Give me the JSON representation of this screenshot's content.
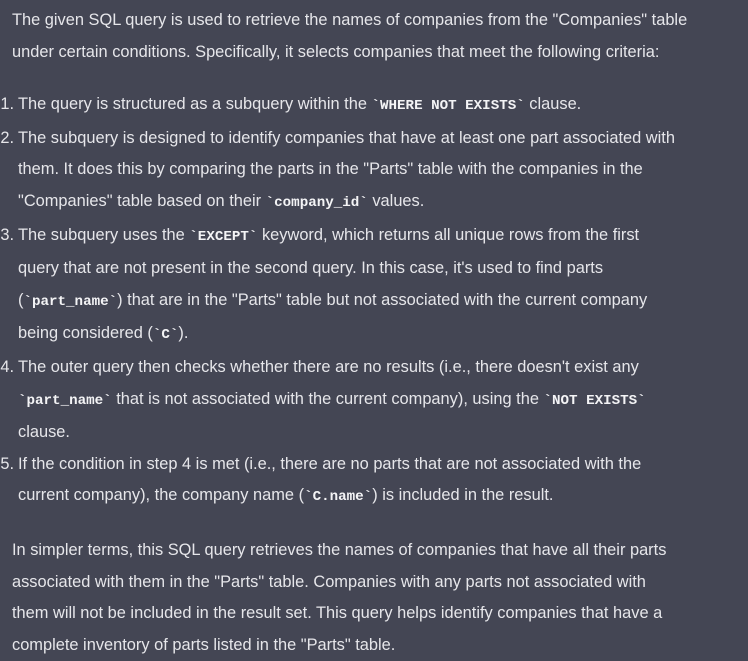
{
  "intro": {
    "line1": "The given SQL query is used to retrieve the names of companies from the \"Companies\" table",
    "line2": "under certain conditions. Specifically, it selects companies that meet the following criteria:"
  },
  "items": [
    {
      "num": "1.",
      "t1": "The query is structured as a subquery within the ",
      "c1": "`WHERE NOT EXISTS`",
      "t2": " clause."
    },
    {
      "num": "2.",
      "t1": "The subquery is designed to identify companies that have at least one part associated with",
      "t2": "them. It does this by comparing the parts in the \"Parts\" table with the companies in the",
      "t3": "\"Companies\" table based on their ",
      "c1": "`company_id`",
      "t4": " values."
    },
    {
      "num": "3.",
      "t1": "The subquery uses the ",
      "c1": "`EXCEPT`",
      "t2": " keyword, which returns all unique rows from the first",
      "t3": "query that are not present in the second query. In this case, it's used to find parts",
      "t4": "(",
      "c2": "`part_name`",
      "t5": ") that are in the \"Parts\" table but not associated with the current company",
      "t6": "being considered (",
      "c3": "`C`",
      "t7": ")."
    },
    {
      "num": "4.",
      "t1": "The outer query then checks whether there are no results (i.e., there doesn't exist any",
      "c1": "`part_name`",
      "t2": " that is not associated with the current company), using the ",
      "c2": "`NOT EXISTS`",
      "t3": "clause."
    },
    {
      "num": "5.",
      "t1": "If the condition in step 4 is met (i.e., there are no parts that are not associated with the",
      "t2": "current company), the company name (",
      "c1": "`C.name`",
      "t3": ") is included in the result."
    }
  ],
  "summary": {
    "line1": "In simpler terms, this SQL query retrieves the names of companies that have all their parts",
    "line2": "associated with them in the \"Parts\" table. Companies with any parts not associated with",
    "line3": "them will not be included in the result set. This query helps identify companies that have a",
    "line4": "complete inventory of parts listed in the \"Parts\" table."
  },
  "colors": {
    "background": "#444654",
    "text": "#e6e6ea"
  }
}
